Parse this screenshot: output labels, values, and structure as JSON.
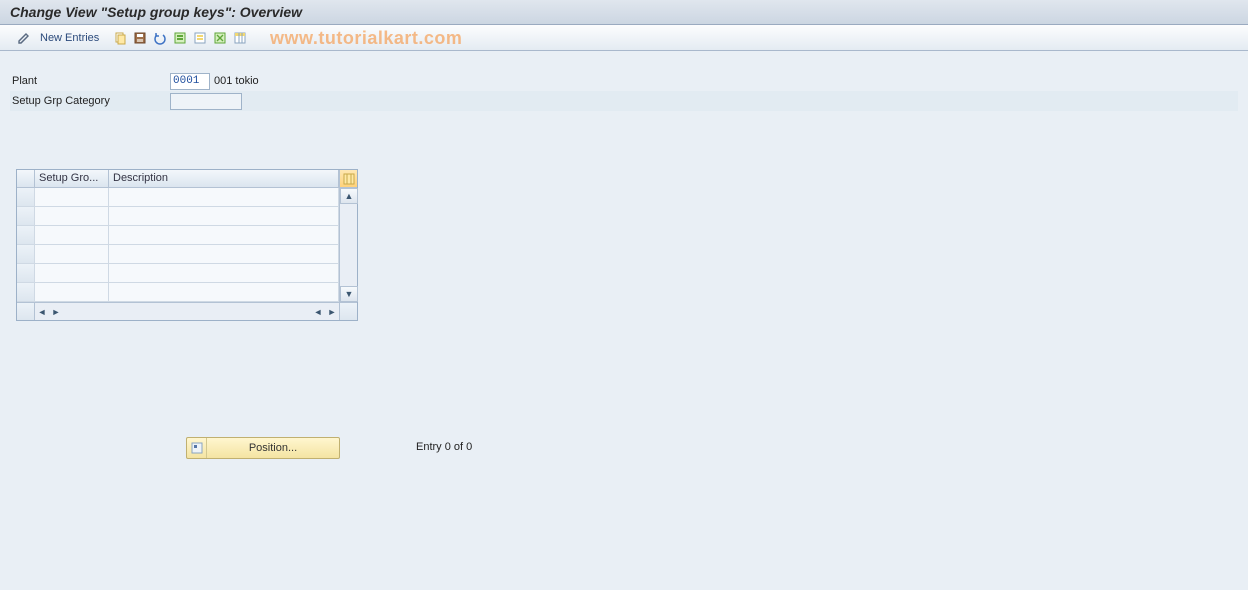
{
  "title": "Change View \"Setup group keys\": Overview",
  "toolbar": {
    "new_entries_label": "New Entries"
  },
  "watermark": "www.tutorialkart.com",
  "form": {
    "plant_label": "Plant",
    "plant_value": "0001",
    "plant_desc": "001 tokio",
    "category_label": "Setup Grp Category",
    "category_value": ""
  },
  "grid": {
    "col1": "Setup Gro...",
    "col2": "Description",
    "rows": [
      {
        "c1": "",
        "c2": ""
      },
      {
        "c1": "",
        "c2": ""
      },
      {
        "c1": "",
        "c2": ""
      },
      {
        "c1": "",
        "c2": ""
      },
      {
        "c1": "",
        "c2": ""
      },
      {
        "c1": "",
        "c2": ""
      }
    ]
  },
  "position_button_label": "Position...",
  "entry_status": "Entry 0 of 0"
}
